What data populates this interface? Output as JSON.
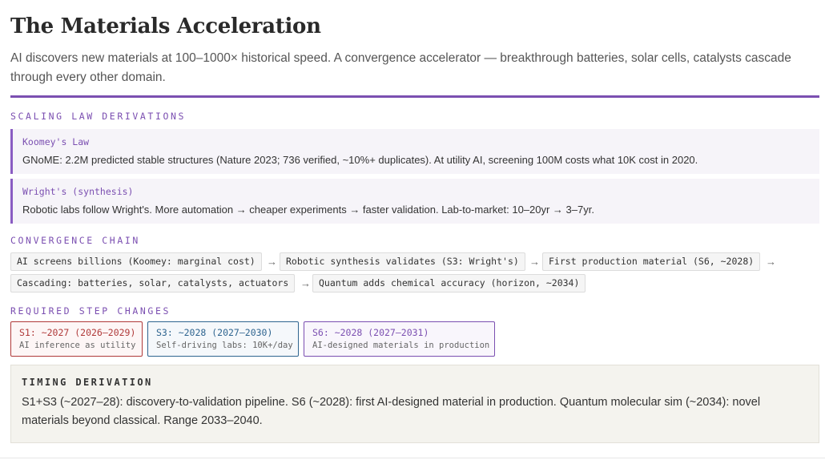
{
  "header": {
    "title": "The Materials Acceleration",
    "subtitle": "AI discovers new materials at 100–1000× historical speed. A convergence accelerator — breakthrough batteries, solar cells, catalysts cascade through every other domain."
  },
  "scaling": {
    "label": "SCALING LAW DERIVATIONS",
    "laws": [
      {
        "name": "Koomey's Law",
        "desc": "GNoME: 2.2M predicted stable structures (Nature 2023; 736 verified, ~10%+ duplicates). At utility AI, screening 100M costs what 10K cost in 2020."
      },
      {
        "name": "Wright's (synthesis)",
        "desc": "Robotic labs follow Wright's. More automation → cheaper experiments → faster validation. Lab-to-market: 10–20yr → 3–7yr."
      }
    ]
  },
  "convergence": {
    "label": "CONVERGENCE CHAIN",
    "arrow": "→",
    "chain": [
      "AI screens billions (Koomey: marginal cost)",
      "Robotic synthesis validates (S3: Wright's)",
      "First production material (S6, ~2028)",
      "Cascading: batteries, solar, catalysts, actuators",
      "Quantum adds chemical accuracy (horizon, ~2034)"
    ]
  },
  "steps": {
    "label": "REQUIRED STEP CHANGES",
    "items": [
      {
        "name": "S1: ~2027 (2026–2029)",
        "desc": "AI inference as utility",
        "color": "#b03a3a",
        "bg": "#fdf6f6"
      },
      {
        "name": "S3: ~2028 (2027–2030)",
        "desc": "Self-driving labs: 10K+/day",
        "color": "#2f6590",
        "bg": "#f5f8fb"
      },
      {
        "name": "S6: ~2028 (2027–2031)",
        "desc": "AI-designed materials in production",
        "color": "#7b4fb1",
        "bg": "#f9f6fc"
      }
    ]
  },
  "timing": {
    "label": "TIMING DERIVATION",
    "text": "S1+S3 (~2027–28): discovery-to-validation pipeline. S6 (~2028): first AI-designed material in production. Quantum molecular sim (~2034): novel materials beyond classical. Range 2033–2040."
  },
  "colors": {
    "accent": "#7b4fb1"
  }
}
